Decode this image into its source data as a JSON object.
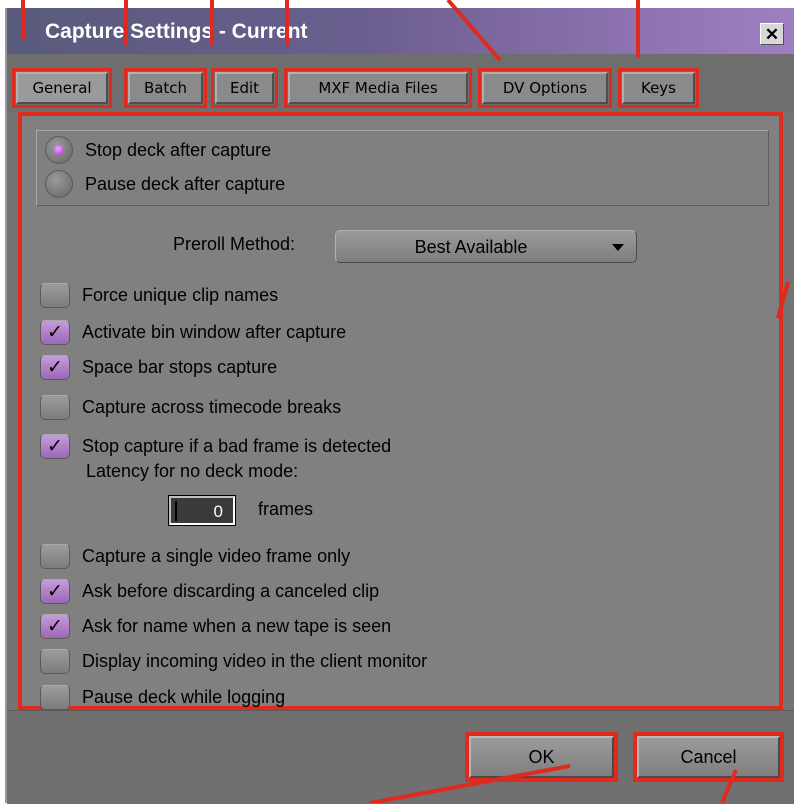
{
  "window": {
    "title": "Capture Settings - Current",
    "close_glyph": "✕"
  },
  "tabs": [
    {
      "label": "General",
      "active": true
    },
    {
      "label": "Batch"
    },
    {
      "label": "Edit"
    },
    {
      "label": "MXF Media Files"
    },
    {
      "label": "DV Options"
    },
    {
      "label": "Keys"
    }
  ],
  "deck_options": [
    {
      "label": "Stop deck after capture",
      "selected": true
    },
    {
      "label": "Pause deck after capture",
      "selected": false
    }
  ],
  "preroll": {
    "label": "Preroll Method:",
    "value": "Best Available"
  },
  "checkboxes_top": [
    {
      "label": "Force unique clip names",
      "checked": false
    },
    {
      "label": "Activate bin window after capture",
      "checked": true
    },
    {
      "label": "Space bar stops capture",
      "checked": true
    },
    {
      "label": "Capture across timecode breaks",
      "checked": false
    },
    {
      "label": "Stop capture if a bad frame is detected",
      "checked": true
    }
  ],
  "latency": {
    "label": "Latency for no deck mode:",
    "value": "0",
    "unit": "frames"
  },
  "checkboxes_bottom": [
    {
      "label": "Capture a single video frame only",
      "checked": false
    },
    {
      "label": "Ask before discarding a canceled clip",
      "checked": true
    },
    {
      "label": "Ask for name when a new tape is seen",
      "checked": true
    },
    {
      "label": "Display incoming video in the client monitor",
      "checked": false
    },
    {
      "label": "Pause deck while logging",
      "checked": false
    }
  ],
  "buttons": {
    "ok": "OK",
    "cancel": "Cancel"
  },
  "check_glyph": "✓",
  "colors": {
    "annotation": "#e02a1d",
    "accent_purple": "#c35ee0",
    "panel": "#808080"
  }
}
